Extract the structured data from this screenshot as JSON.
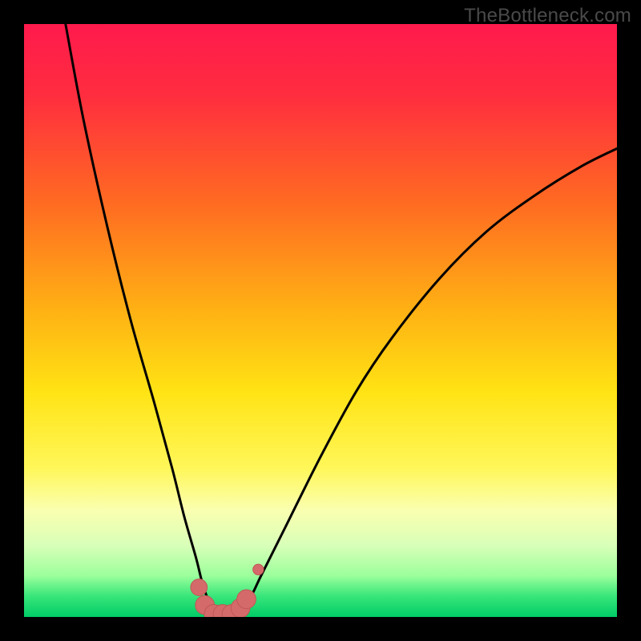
{
  "watermark": "TheBottleneck.com",
  "colors": {
    "frame": "#000000",
    "gradient_stops": [
      {
        "offset": 0.0,
        "color": "#ff1a4d"
      },
      {
        "offset": 0.12,
        "color": "#ff2d3f"
      },
      {
        "offset": 0.3,
        "color": "#ff6a22"
      },
      {
        "offset": 0.48,
        "color": "#ffb014"
      },
      {
        "offset": 0.62,
        "color": "#ffe314"
      },
      {
        "offset": 0.75,
        "color": "#fff75a"
      },
      {
        "offset": 0.82,
        "color": "#faffb0"
      },
      {
        "offset": 0.88,
        "color": "#d8ffb8"
      },
      {
        "offset": 0.93,
        "color": "#9cff9c"
      },
      {
        "offset": 0.965,
        "color": "#38e67a"
      },
      {
        "offset": 1.0,
        "color": "#00cc66"
      }
    ],
    "curve": "#000000",
    "marker_fill": "#d46a6a",
    "marker_stroke": "#c05858"
  },
  "chart_data": {
    "type": "line",
    "title": "",
    "xlabel": "",
    "ylabel": "",
    "xlim": [
      0,
      100
    ],
    "ylim": [
      0,
      100
    ],
    "series": [
      {
        "name": "bottleneck-curve",
        "x": [
          7,
          10,
          14,
          18,
          22,
          25,
          27,
          29,
          30,
          31,
          32,
          33,
          34,
          35,
          36,
          38,
          40,
          44,
          50,
          56,
          62,
          70,
          78,
          86,
          94,
          100
        ],
        "y": [
          100,
          84,
          66,
          50,
          36,
          25,
          17,
          10,
          6,
          3,
          1,
          0,
          0,
          0,
          1,
          3,
          7,
          15,
          27,
          38,
          47,
          57,
          65,
          71,
          76,
          79
        ]
      }
    ],
    "markers": {
      "name": "highlight-band",
      "x": [
        29.5,
        30.5,
        32,
        33.5,
        35,
        36.5,
        37.5,
        39.5
      ],
      "y": [
        5,
        2,
        0.5,
        0.5,
        0.5,
        1.5,
        3,
        8
      ],
      "r": [
        1.4,
        1.6,
        1.6,
        1.6,
        1.6,
        1.6,
        1.6,
        0.9
      ]
    }
  }
}
